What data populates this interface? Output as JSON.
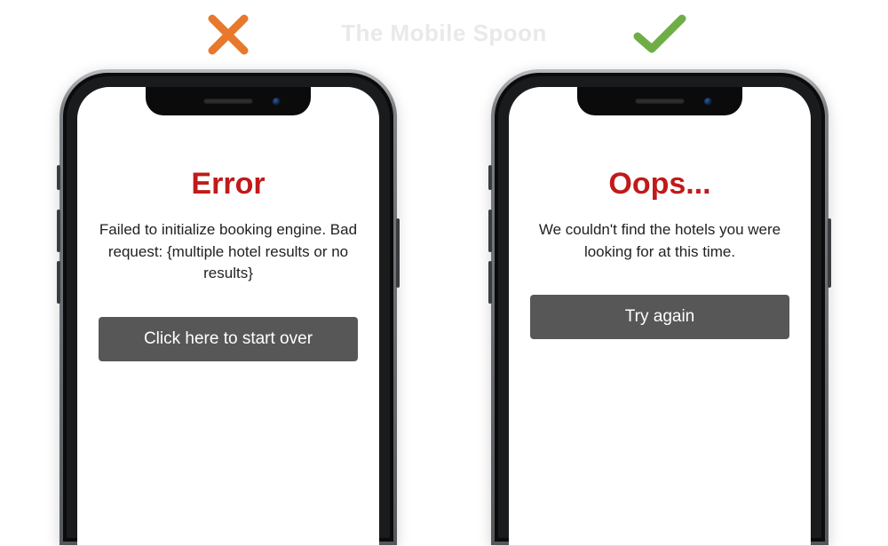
{
  "watermark": "The Mobile Spoon",
  "bad": {
    "mark": "cross",
    "title": "Error",
    "body": "Failed to initialize booking engine. Bad request: {multiple hotel results or no results}",
    "cta": "Click here to start over"
  },
  "good": {
    "mark": "check",
    "title": "Oops...",
    "body": "We couldn't find the hotels you were looking for at this time.",
    "cta": "Try again"
  },
  "colors": {
    "cross": "#e8782b",
    "check": "#6fae46",
    "error_title": "#c11a1a",
    "cta_bg": "#575757"
  }
}
